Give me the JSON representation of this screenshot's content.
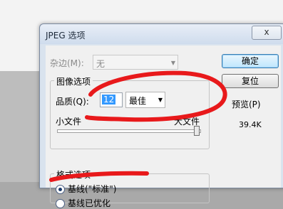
{
  "dialog": {
    "title": "JPEG 选项",
    "close_label": "x",
    "matte": {
      "label": "杂边(M):",
      "value": "无"
    },
    "image_options": {
      "title": "图像选项",
      "quality_label": "品质(Q):",
      "quality_value": "12",
      "quality_preset": "最佳",
      "small_file_label": "小文件",
      "large_file_label": "大文件"
    },
    "format_options": {
      "title": "格式选项",
      "baseline_label": "基线(\"标准\")",
      "baseline_optimized_label": "基线已优化"
    },
    "buttons": {
      "ok": "确定",
      "reset": "复位"
    },
    "preview_label": "预览(P)",
    "file_size": "39.4K"
  },
  "annotation": {
    "color": "#e8191b"
  }
}
